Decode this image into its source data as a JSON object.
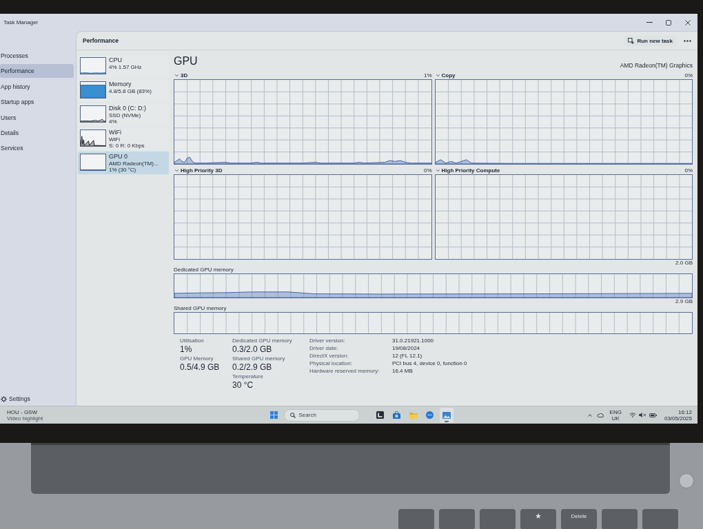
{
  "window": {
    "title": "Task Manager"
  },
  "nav": {
    "items": [
      {
        "label": "Processes",
        "selected": false
      },
      {
        "label": "Performance",
        "selected": true
      },
      {
        "label": "App history",
        "selected": false
      },
      {
        "label": "Startup apps",
        "selected": false
      },
      {
        "label": "Users",
        "selected": false
      },
      {
        "label": "Details",
        "selected": false
      },
      {
        "label": "Services",
        "selected": false
      }
    ],
    "settings": {
      "label": "Settings"
    }
  },
  "header": {
    "title": "Performance",
    "action": {
      "label": "Run new task"
    }
  },
  "devices": [
    {
      "kind": "cpu",
      "name": "CPU",
      "lines": [
        "4% 1.57 GHz"
      ],
      "selected": false
    },
    {
      "kind": "memory",
      "name": "Memory",
      "lines": [
        "4.8/5.8 GB (83%)"
      ],
      "selected": false
    },
    {
      "kind": "disk",
      "name": "Disk 0 (C: D:)",
      "lines": [
        "SSD (NVMe)",
        "4%"
      ],
      "selected": false
    },
    {
      "kind": "network",
      "name": "WiFi",
      "lines": [
        "WiFi",
        "S: 0 R: 0 Kbps"
      ],
      "selected": false
    },
    {
      "kind": "gpu",
      "name": "GPU 0",
      "lines": [
        "AMD Radeon(TM)...",
        "1% (30 °C)"
      ],
      "selected": true
    }
  ],
  "detail": {
    "title": "GPU",
    "model": "AMD Radeon(TM) Graphics",
    "engines": [
      {
        "label": "3D",
        "reading": "1%"
      },
      {
        "label": "Copy",
        "reading": "0%"
      },
      {
        "label": "High Priority 3D",
        "reading": "0%"
      },
      {
        "label": "High Priority Compute",
        "reading": "0%"
      }
    ],
    "memory_graphs": [
      {
        "label": "Dedicated GPU memory",
        "max": "2.0 GB"
      },
      {
        "label": "Shared GPU memory",
        "max": "2.9 GB"
      }
    ],
    "stat_columns": [
      {
        "stats": [
          {
            "label": "Utilisation",
            "value": "1%"
          },
          {
            "label": "GPU Memory",
            "value": "0.5/4.9 GB"
          }
        ]
      },
      {
        "stats": [
          {
            "label": "Dedicated GPU memory",
            "value": "0.3/2.0 GB"
          },
          {
            "label": "Shared GPU memory",
            "value": "0.2/2.9 GB"
          },
          {
            "label": "Temperature",
            "value": "30 °C"
          }
        ]
      }
    ],
    "properties": [
      {
        "label": "Driver version:",
        "value": "31.0.21921.1000"
      },
      {
        "label": "Driver date:",
        "value": "19/08/2024"
      },
      {
        "label": "DirectX version:",
        "value": "12 (FL 12.1)"
      },
      {
        "label": "Physical location:",
        "value": "PCI bus 4, device 0, function 0"
      },
      {
        "label": "Hardware reserved memory:",
        "value": "16.4 MB"
      }
    ]
  },
  "taskbar": {
    "widget": {
      "title": "HOU - GSW",
      "subtitle": "Video highlight"
    },
    "search": {
      "placeholder": "Search"
    },
    "apps": [
      {
        "kind": "tile",
        "active": false
      },
      {
        "kind": "store",
        "active": false
      },
      {
        "kind": "folder",
        "active": false
      },
      {
        "kind": "chat",
        "active": false
      },
      {
        "kind": "photos",
        "active": true
      }
    ],
    "language": [
      "ENG",
      "UK"
    ],
    "time": "16:12",
    "date": "03/05/2025"
  },
  "keyboard": {
    "keys": [
      {
        "kind": "plain"
      },
      {
        "kind": "plain"
      },
      {
        "kind": "plain"
      },
      {
        "kind": "icon"
      },
      {
        "kind": "text",
        "label": "Delete"
      },
      {
        "kind": "plain"
      },
      {
        "kind": "plain"
      }
    ]
  }
}
